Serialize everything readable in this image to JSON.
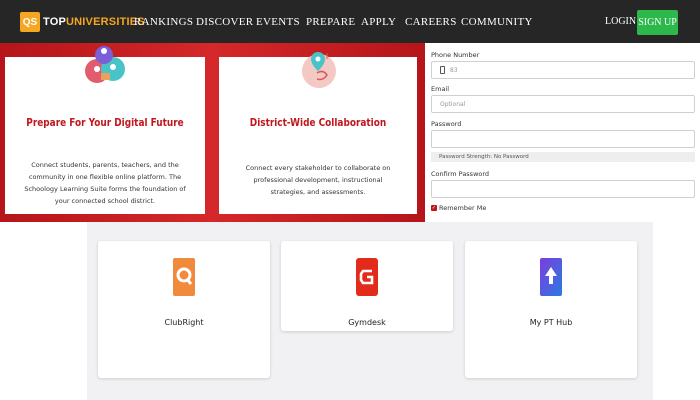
{
  "nav": {
    "logo_box": "QS",
    "logo_text_1": "TOP",
    "logo_text_2": "UNIVERSITIES",
    "items": [
      "RANKINGS",
      "DISCOVER",
      "EVENTS",
      "PREPARE",
      "APPLY",
      "CAREERS",
      "COMMUNITY"
    ],
    "login": "LOGIN",
    "signup": "SIGN UP"
  },
  "banner": {
    "cards": [
      {
        "title": "Prepare For Your Digital Future",
        "desc": "Connect students, parents, teachers, and the community in one flexible online platform. The Schoology Learning Suite forms the foundation of your connected school district."
      },
      {
        "title": "District-Wide Collaboration",
        "desc": "Connect every stakeholder to collaborate on professional development, instructional strategies, and assessments."
      }
    ]
  },
  "form": {
    "phone_label": "Phone Number",
    "phone_value": "83",
    "email_label": "Email",
    "email_placeholder": "Optional",
    "password_label": "Password",
    "password_strength": "Password Strength: No Password",
    "confirm_label": "Confirm Password",
    "remember_label": "Remember Me"
  },
  "apps": [
    {
      "name": "ClubRight",
      "icon": "clubright-logo-icon"
    },
    {
      "name": "Gymdesk",
      "icon": "gymdesk-logo-icon"
    },
    {
      "name": "My PT Hub",
      "icon": "my-pt-hub-logo-icon"
    }
  ],
  "colors": {
    "brand_red": "#c0161c",
    "nav_bg": "#262626",
    "signup_green": "#2db84c",
    "logo_orange": "#f5a623"
  }
}
